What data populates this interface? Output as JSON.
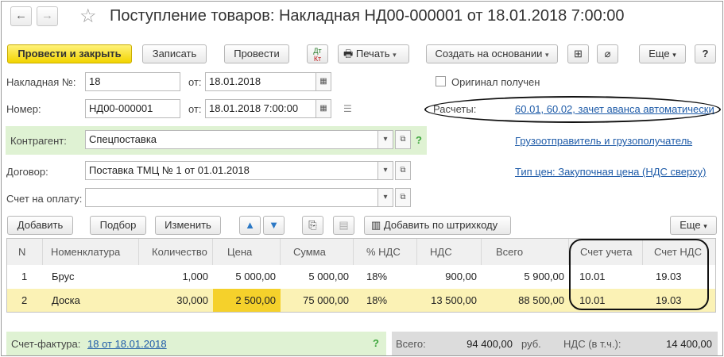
{
  "window": {
    "title": "Поступление товаров: Накладная НД00-000001 от 18.01.2018 7:00:00",
    "star_icon": "star-icon"
  },
  "toolbar": {
    "post_close": "Провести и закрыть",
    "save": "Записать",
    "post": "Провести",
    "dt_kt_top": "Дт",
    "dt_kt_bottom": "Кт",
    "print": "Печать",
    "create_based": "Создать на основании",
    "more": "Еще",
    "help": "?"
  },
  "form": {
    "invoice_no_label": "Накладная №:",
    "invoice_no_value": "18",
    "from_label": "от:",
    "invoice_date": "18.01.2018",
    "number_label": "Номер:",
    "number_value": "НД00-000001",
    "number_from_label": "от:",
    "number_datetime": "18.01.2018  7:00:00",
    "original_label": "Оригинал получен",
    "original_checked": false,
    "settlements_label": "Расчеты:",
    "settlements_link": "60.01, 60.02, зачет аванса автоматически",
    "counterparty_label": "Контрагент:",
    "counterparty_value": "Спецпоставка",
    "shipper_link": "Грузоотправитель и грузополучатель",
    "contract_label": "Договор:",
    "contract_value": "Поставка ТМЦ № 1 от 01.01.2018",
    "price_type_link": "Тип цен: Закупочная цена (НДС сверху)",
    "payment_invoice_label": "Счет на оплату:",
    "payment_invoice_value": ""
  },
  "table_toolbar": {
    "add": "Добавить",
    "pick": "Подбор",
    "change": "Изменить",
    "barcode": "Добавить по штрихкоду",
    "more": "Еще"
  },
  "table": {
    "columns": [
      "N",
      "Номенклатура",
      "Количество",
      "Цена",
      "Сумма",
      "% НДС",
      "НДС",
      "Всего",
      "Счет учета",
      "Счет НДС"
    ],
    "rows": [
      [
        "1",
        "Брус",
        "1,000",
        "5 000,00",
        "5 000,00",
        "18%",
        "900,00",
        "5 900,00",
        "10.01",
        "19.03"
      ],
      [
        "2",
        "Доска",
        "30,000",
        "2 500,00",
        "75 000,00",
        "18%",
        "13 500,00",
        "88 500,00",
        "10.01",
        "19.03"
      ]
    ]
  },
  "footer": {
    "invoice_label": "Счет-фактура:",
    "invoice_link": "18 от 18.01.2018",
    "help": "?",
    "total_label": "Всего:",
    "total_value": "94 400,00",
    "currency": "руб.",
    "vat_label": "НДС (в т.ч.):",
    "vat_value": "14 400,00"
  },
  "colors": {
    "accent_yellow": "#f2d400",
    "selected_row": "#fbf2b5",
    "selected_cell": "#f5d12b",
    "link": "#1e5ba8",
    "green_panel": "#dff2d3"
  }
}
